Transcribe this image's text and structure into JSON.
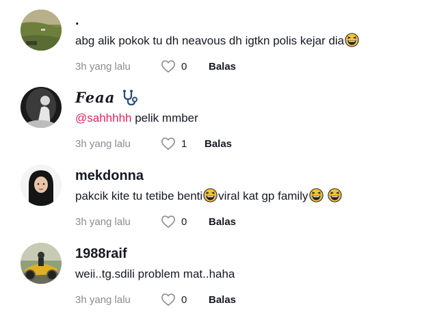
{
  "comments": [
    {
      "username": ".",
      "text": "abg alik pokok tu dh neavous dh igtkn polis kejar dia",
      "time": "3h yang lalu",
      "likes": "0",
      "reply": "Balas"
    },
    {
      "username": "Feaa",
      "mention": "@sahhhhh",
      "text": " pelik mmber",
      "time": "3h yang lalu",
      "likes": "1",
      "reply": "Balas"
    },
    {
      "username": "mekdonna",
      "text_a": "pakcik kite tu tetibe benti",
      "text_b": "viral kat gp family",
      "time": "3h yang lalu",
      "likes": "0",
      "reply": "Balas"
    },
    {
      "username": "1988raif",
      "text": "weii..tg.sdili problem mat..haha",
      "time": "3h yang lalu",
      "likes": "0",
      "reply": "Balas"
    }
  ],
  "icons": {
    "emoji": "grinning-squinting-face-with-tears",
    "like": "heart-outline-icon",
    "badge": "stethoscope-icon"
  },
  "colors": {
    "mention": "#e0245e",
    "muted": "#8a8b91",
    "text": "#161823"
  }
}
